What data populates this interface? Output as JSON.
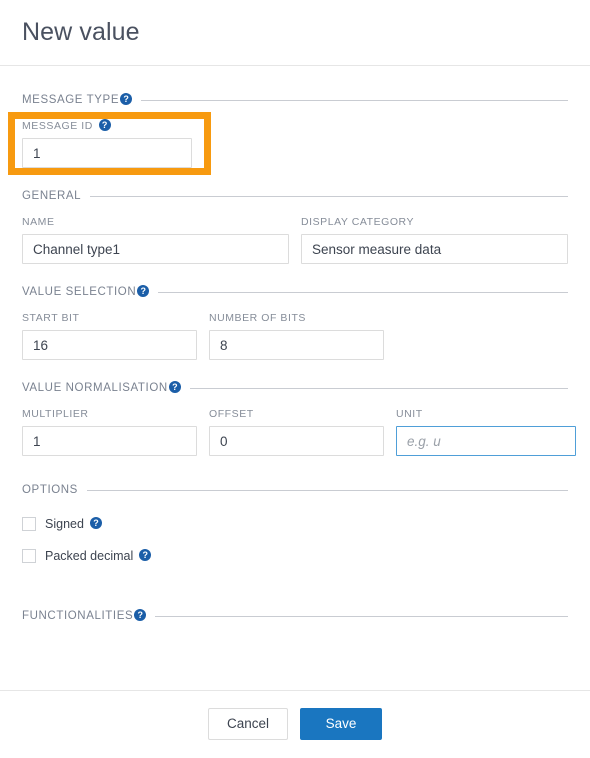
{
  "header": {
    "title": "New value"
  },
  "sections": {
    "message_type": {
      "label": "MESSAGE TYPE",
      "help_icon": "help-circle-icon",
      "fields": {
        "message_id": {
          "label": "MESSAGE ID",
          "value": "1",
          "help_icon": "help-circle-icon"
        }
      }
    },
    "general": {
      "label": "GENERAL",
      "fields": {
        "name": {
          "label": "NAME",
          "value": "Channel type1"
        },
        "display_category": {
          "label": "DISPLAY CATEGORY",
          "value": "Sensor measure data"
        }
      }
    },
    "value_selection": {
      "label": "VALUE SELECTION",
      "help_icon": "help-circle-icon",
      "fields": {
        "start_bit": {
          "label": "START BIT",
          "value": "16"
        },
        "number_of_bits": {
          "label": "NUMBER OF BITS",
          "value": "8"
        }
      }
    },
    "value_normalisation": {
      "label": "VALUE NORMALISATION",
      "help_icon": "help-circle-icon",
      "fields": {
        "multiplier": {
          "label": "MULTIPLIER",
          "value": "1"
        },
        "offset": {
          "label": "OFFSET",
          "value": "0"
        },
        "unit": {
          "label": "UNIT",
          "value": "",
          "placeholder": "e.g. u",
          "focused": true
        }
      }
    },
    "options": {
      "label": "OPTIONS",
      "checkboxes": [
        {
          "label": "Signed",
          "checked": false,
          "help_icon": "help-circle-icon"
        },
        {
          "label": "Packed decimal",
          "checked": false,
          "help_icon": "help-circle-icon"
        }
      ]
    },
    "functionalities": {
      "label": "FUNCTIONALITIES",
      "help_icon": "help-circle-icon"
    }
  },
  "footer": {
    "cancel_label": "Cancel",
    "save_label": "Save"
  },
  "icons": {
    "help_glyph": "?"
  },
  "colors": {
    "accent_blue": "#1a76c0",
    "help_blue": "#1b5ea8",
    "highlight_orange": "#f79a10",
    "focus_border": "#4f9fd8",
    "label_gray": "#868d99",
    "rule_gray": "#c9ccd2"
  }
}
